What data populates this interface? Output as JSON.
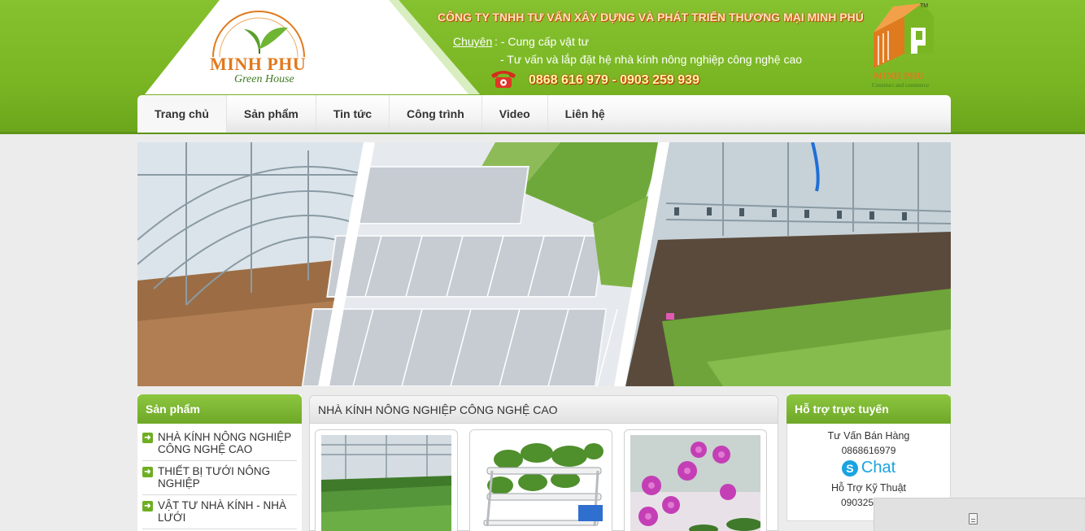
{
  "header": {
    "logo_text": "MINH PHU",
    "logo_subtext": "Green House",
    "company_name": "CÔNG TY TNHH TƯ VẤN XÂY DỰNG VÀ PHÁT TRIỂN THƯƠNG MẠI MINH PHÚ",
    "specialty_label": "Chuyên",
    "specialty_line1": ": - Cung cấp vật tư",
    "specialty_line2": "- Tư vấn và lắp đặt hệ nhà kính nông nghiệp công nghệ cao",
    "phone": "0868 616 979 - 0903 259 939",
    "brand_name": "MINH PHU",
    "brand_tagline": "Construct and commerce",
    "brand_tm": "TM",
    "colors": {
      "header_green": "#7ab623",
      "accent_orange": "#e07a1e",
      "company_text": "#ffe2c0"
    }
  },
  "nav": {
    "items": [
      {
        "label": "Trang chủ",
        "active": true
      },
      {
        "label": "Sản phẩm"
      },
      {
        "label": "Tin tức"
      },
      {
        "label": "Công trình"
      },
      {
        "label": "Video"
      },
      {
        "label": "Liên hệ"
      }
    ]
  },
  "left_sidebar": {
    "title": "Sản phẩm",
    "items": [
      {
        "label": "NHÀ KÍNH NÔNG NGHIỆP CÔNG NGHỆ CAO"
      },
      {
        "label": "THIẾT BỊ TƯỚI NÔNG NGHIỆP"
      },
      {
        "label": "VẬT TƯ NHÀ KÍNH - NHÀ LƯỚI"
      }
    ]
  },
  "main": {
    "section_title": "NHÀ KÍNH NÔNG NGHIỆP CÔNG NGHỆ CAO"
  },
  "right_sidebar": {
    "title": "Hỗ trợ trực tuyến",
    "sales_title": "Tư Vấn Bán Hàng",
    "sales_phone": "0868616979",
    "chat_label": "Chat",
    "tech_title": "Hỗ Trợ Kỹ Thuật",
    "tech_phone": "090325"
  }
}
